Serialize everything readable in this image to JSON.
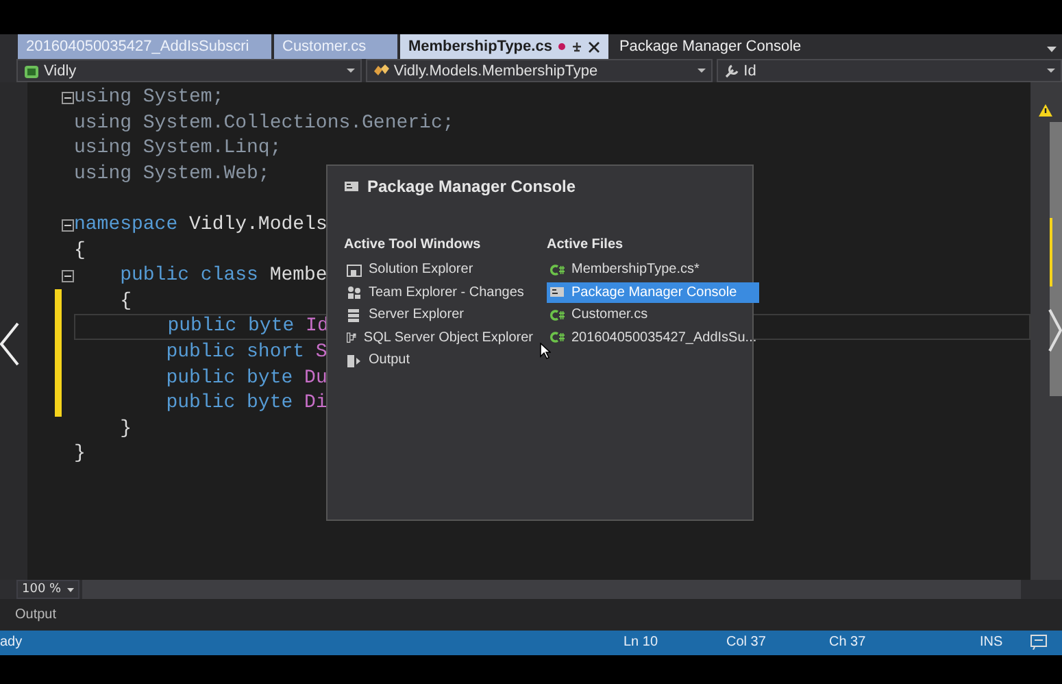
{
  "tabs": [
    {
      "label": "201604050035427_AddIsSubscri",
      "kind": "doc",
      "selected": false,
      "modified": false
    },
    {
      "label": "Customer.cs",
      "kind": "doc",
      "selected": false,
      "modified": false
    },
    {
      "label": "MembershipType.cs",
      "kind": "doc",
      "selected": true,
      "modified": true
    },
    {
      "label": "Package Manager Console",
      "kind": "tool",
      "selected": false,
      "modified": false
    }
  ],
  "navigation": [
    "Vidly",
    "Vidly.Models.MembershipType",
    "Id"
  ],
  "code_lines": [
    {
      "fold": true,
      "changed": false,
      "current": false,
      "tokens": [
        {
          "kind": "dim",
          "text": "using System;"
        }
      ]
    },
    {
      "fold": false,
      "changed": false,
      "current": false,
      "tokens": [
        {
          "kind": "dim",
          "text": "using System.Collections.Generic;"
        }
      ]
    },
    {
      "fold": false,
      "changed": false,
      "current": false,
      "tokens": [
        {
          "kind": "dim",
          "text": "using System.Linq;"
        }
      ]
    },
    {
      "fold": false,
      "changed": false,
      "current": false,
      "tokens": [
        {
          "kind": "dim",
          "text": "using System.Web;"
        }
      ]
    },
    {
      "fold": false,
      "changed": false,
      "current": false
    },
    {
      "fold": true,
      "changed": false,
      "current": false,
      "tokens": [
        {
          "kind": "keyword",
          "text": "namespace"
        },
        {
          "kind": "plain",
          "text": " Vidly.Models"
        }
      ]
    },
    {
      "fold": false,
      "changed": false,
      "current": false,
      "tokens": [
        {
          "kind": "plain",
          "text": "{"
        }
      ]
    },
    {
      "fold": true,
      "changed": false,
      "current": false,
      "tokens": [
        {
          "kind": "keyword",
          "text": "    public class"
        },
        {
          "kind": "plain",
          "text": " Membe"
        }
      ]
    },
    {
      "fold": false,
      "changed": true,
      "current": false,
      "tokens": [
        {
          "kind": "plain",
          "text": "    {"
        }
      ]
    },
    {
      "fold": false,
      "changed": true,
      "current": true,
      "tokens": [
        {
          "kind": "keyword",
          "text": "        public byte"
        },
        {
          "kind": "member",
          "text": " Id"
        }
      ]
    },
    {
      "fold": false,
      "changed": true,
      "current": false,
      "tokens": [
        {
          "kind": "keyword",
          "text": "        public short"
        },
        {
          "kind": "member",
          "text": " S"
        }
      ]
    },
    {
      "fold": false,
      "changed": true,
      "current": false,
      "tokens": [
        {
          "kind": "keyword",
          "text": "        public byte"
        },
        {
          "kind": "member",
          "text": " Du"
        }
      ]
    },
    {
      "fold": false,
      "changed": true,
      "current": false,
      "tokens": [
        {
          "kind": "keyword",
          "text": "        public byte"
        },
        {
          "kind": "member",
          "text": " Di"
        }
      ]
    },
    {
      "fold": false,
      "changed": false,
      "current": false,
      "tokens": [
        {
          "kind": "plain",
          "text": "    }"
        }
      ]
    },
    {
      "fold": false,
      "changed": false,
      "current": false,
      "tokens": [
        {
          "kind": "plain",
          "text": "}"
        }
      ]
    }
  ],
  "switcher": {
    "title": "Package Manager Console",
    "columns": [
      {
        "heading": "Active Tool Windows",
        "items": [
          {
            "label": "Solution Explorer",
            "selected": false
          },
          {
            "label": "Team Explorer - Changes",
            "selected": false
          },
          {
            "label": "Server Explorer",
            "selected": false
          },
          {
            "label": "SQL Server Object Explorer",
            "selected": false
          },
          {
            "label": "Output",
            "selected": false
          }
        ]
      },
      {
        "heading": "Active Files",
        "items": [
          {
            "label": "MembershipType.cs*",
            "kind": "code",
            "selected": false
          },
          {
            "label": "Package Manager Console",
            "kind": "console",
            "selected": true
          },
          {
            "label": "Customer.cs",
            "kind": "code",
            "selected": false
          },
          {
            "label": "201604050035427_AddIsSu...",
            "kind": "code",
            "selected": false
          }
        ]
      }
    ]
  },
  "zoom": "100 %",
  "output_panel": {
    "title": "Output"
  },
  "status_bar": {
    "message": "ady",
    "line": "Ln 10",
    "column": "Col 37",
    "char": "Ch 37",
    "mode": "INS"
  }
}
